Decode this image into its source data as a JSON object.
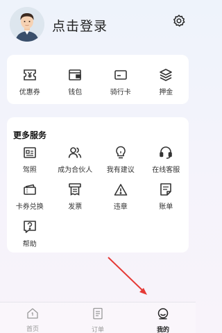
{
  "profile": {
    "login_label": "点击登录"
  },
  "wallet_row": [
    {
      "label": "优惠券",
      "icon": "coupon-icon"
    },
    {
      "label": "钱包",
      "icon": "wallet-icon"
    },
    {
      "label": "骑行卡",
      "icon": "ride-card-icon"
    },
    {
      "label": "押金",
      "icon": "deposit-icon"
    }
  ],
  "more_services": {
    "title": "更多服务",
    "items": [
      {
        "label": "驾照",
        "icon": "license-icon"
      },
      {
        "label": "成为合伙人",
        "icon": "partner-icon"
      },
      {
        "label": "我有建议",
        "icon": "lightbulb-icon"
      },
      {
        "label": "在线客服",
        "icon": "headset-icon"
      },
      {
        "label": "卡券兑换",
        "icon": "ticket-icon"
      },
      {
        "label": "发票",
        "icon": "invoice-icon"
      },
      {
        "label": "违章",
        "icon": "warning-icon"
      },
      {
        "label": "账单",
        "icon": "bill-icon"
      },
      {
        "label": "帮助",
        "icon": "help-icon"
      }
    ]
  },
  "tabs": [
    {
      "label": "首页",
      "icon": "home-icon",
      "active": false
    },
    {
      "label": "订单",
      "icon": "order-icon",
      "active": false
    },
    {
      "label": "我的",
      "icon": "profile-icon",
      "active": true
    }
  ],
  "colors": {
    "arrow": "#e53935",
    "icon_stroke": "#333333",
    "tab_inactive": "#999999"
  }
}
